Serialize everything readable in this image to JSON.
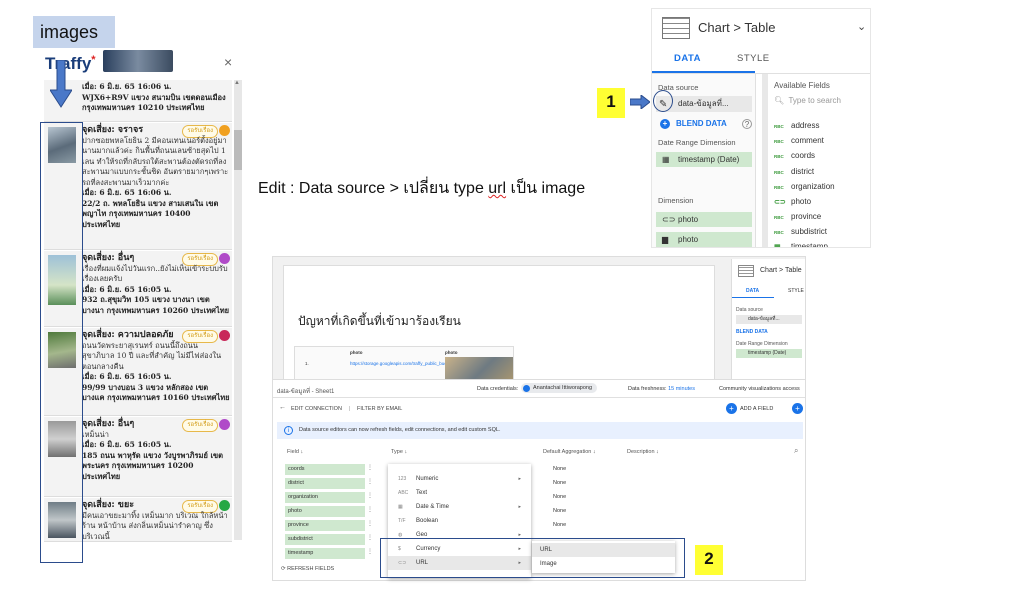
{
  "label_images": "images",
  "traffy": {
    "logo": "Traffy",
    "logo_star": "*",
    "close": "×",
    "top_meta": "เมื่อ: 6 มิ.ย. 65 16:06 น.",
    "top_addr": "WJX6+R9V แขวง สนามบิน เขตดอนเมือง กรุงเทพมหานคร 10210 ประเทศไทย",
    "reports": [
      {
        "category": "จุดเสี่ยง: จราจร",
        "badge": "รอรับเรื่อง",
        "desc": "ปากซอยพหลโยธิน 2 มีคอนเทนเนอร์ตั้งอยู่มานานมากแล้วค่ะ กินพื้นที่ถนนเลนซ้ายสุดไป 1 เลน ทำให้รถที่กลับรถใต้สะพานต้องตัดรถที่ลงสะพานมาแบบกระชั้นชิด อันตรายมากๆเพราะรถที่ลงสะพานมาเร็วมากค่ะ",
        "time": "เมื่อ: 6 มิ.ย. 65 16:06 น.",
        "addr": "22/2 ถ. พหลโยธิน แขวง สามเสนใน เขตพญาไท กรุงเทพมหานคร 10400 ประเทศไทย"
      },
      {
        "category": "จุดเสี่ยง: อื่นๆ",
        "badge": "รอรับเรื่อง",
        "desc": "เรื่องที่ผมแจ้งไปวันแรก..ยังไม่เห็นเข้าระบบรับเรื่องเลยครับ",
        "time": "เมื่อ: 6 มิ.ย. 65 16:05 น.",
        "addr": "932 ถ.สุขุมวิท 105 แขวง บางนา เขตบางนา กรุงเทพมหานคร 10260 ประเทศไทย"
      },
      {
        "category": "จุดเสี่ยง: ความปลอดภัย",
        "badge": "รอรับเรื่อง",
        "desc": "ถนนวัดพระยาสุเรนทร์ ถนนนี้ถึงถนนสุขาภิบาล 10 ปี และที่สำคัญ ไม่มีไฟส่องในตอนกลางคืน",
        "time": "เมื่อ: 6 มิ.ย. 65 16:05 น.",
        "addr": "99/99 บางบอน 3 แขวง หลักสอง เขตบางแค กรุงเทพมหานคร 10160 ประเทศไทย"
      },
      {
        "category": "จุดเสี่ยง: อื่นๆ",
        "badge": "รอรับเรื่อง",
        "desc": "เหม็นน่า",
        "time": "เมื่อ: 6 มิ.ย. 65 16:05 น.",
        "addr": "185 ถนน พาหุรัด แขวง วังบูรพาภิรมย์ เขตพระนคร กรุงเทพมหานคร 10200 ประเทศไทย"
      },
      {
        "category": "จุดเสี่ยง: ขยะ",
        "badge": "รอรับเรื่อง",
        "desc": "มีคนเอาขยะมาทิ้ง เหม็นมาก บริเวณ ใกล้หน้าร้าน หน้าบ้าน ส่งกลิ่นเหม็นน่ารำคาญ ซึ่งบริเวณนี้",
        "time": "",
        "addr": ""
      }
    ]
  },
  "data_panel": {
    "breadcrumb": "Chart > Table",
    "tab_data": "DATA",
    "tab_style": "STYLE",
    "data_source_title": "Data source",
    "data_source_name": "data-ข้อมูลที่...",
    "blend_data": "BLEND DATA",
    "date_range_title": "Date Range Dimension",
    "date_range_field": "timestamp (Date)",
    "dimension_title": "Dimension",
    "dimension_fields": [
      "photo",
      "photo"
    ],
    "available_fields_title": "Available Fields",
    "search_placeholder": "Type to search",
    "available_fields": [
      "address",
      "comment",
      "coords",
      "district",
      "organization",
      "photo",
      "province",
      "subdistrict",
      "timestamp"
    ]
  },
  "step1": "1",
  "step2": "2",
  "edit_note": {
    "prefix": "Edit : Data source > เปลี่ยน type ",
    "url_word": "url",
    "suffix": " เป็น image"
  },
  "bottom": {
    "report_title": "ปัญหาที่เกิดขึ้นที่เข้ามาร้องเรียน",
    "table_headers": [
      "photo",
      "photo"
    ],
    "table_row_num": "1.",
    "table_link": "https://storage.googleapis.com/traffy_public_buc",
    "mini_panel": {
      "breadcrumb": "Chart > Table",
      "tab_data": "DATA",
      "tab_style": "STYLE",
      "data_source": "Data source",
      "ds_name": "data-ข้อมูลที่...",
      "blend": "BLEND DATA",
      "date_range": "Date Range Dimension",
      "date_field": "timestamp (Date)"
    },
    "editor": {
      "title": "data-ข้อมูลที่ - Sheet1",
      "credentials_label": "Data credentials:",
      "user": "Anantachai Ittiworapong",
      "freshness_label": "Data freshness:",
      "freshness_value": "15 minutes",
      "community": "Community visualizations access",
      "edit_connection": "EDIT CONNECTION",
      "separator": "|",
      "filter_by_email": "FILTER BY EMAIL",
      "add_field": "ADD A FIELD",
      "info": "Data source editors can now refresh fields, edit connections, and edit custom SQL.",
      "col_field": "Field",
      "col_type": "Type",
      "col_agg": "Default Aggregation",
      "col_desc": "Description",
      "fields": [
        "coords",
        "district",
        "organization",
        "photo",
        "province",
        "subdistrict",
        "timestamp"
      ],
      "aggregations": [
        "None",
        "None",
        "None",
        "None",
        "None"
      ],
      "refresh": "REFRESH FIELDS",
      "type_menu": [
        {
          "icon": "123",
          "label": "Numeric",
          "has_sub": true
        },
        {
          "icon": "ABC",
          "label": "Text",
          "has_sub": false
        },
        {
          "icon": "calendar",
          "label": "Date & Time",
          "has_sub": true
        },
        {
          "icon": "T/F",
          "label": "Boolean",
          "has_sub": false
        },
        {
          "icon": "globe",
          "label": "Geo",
          "has_sub": true
        },
        {
          "icon": "$",
          "label": "Currency",
          "has_sub": true
        },
        {
          "icon": "link",
          "label": "URL",
          "has_sub": true
        }
      ],
      "url_submenu": [
        "URL",
        "Image"
      ]
    }
  }
}
